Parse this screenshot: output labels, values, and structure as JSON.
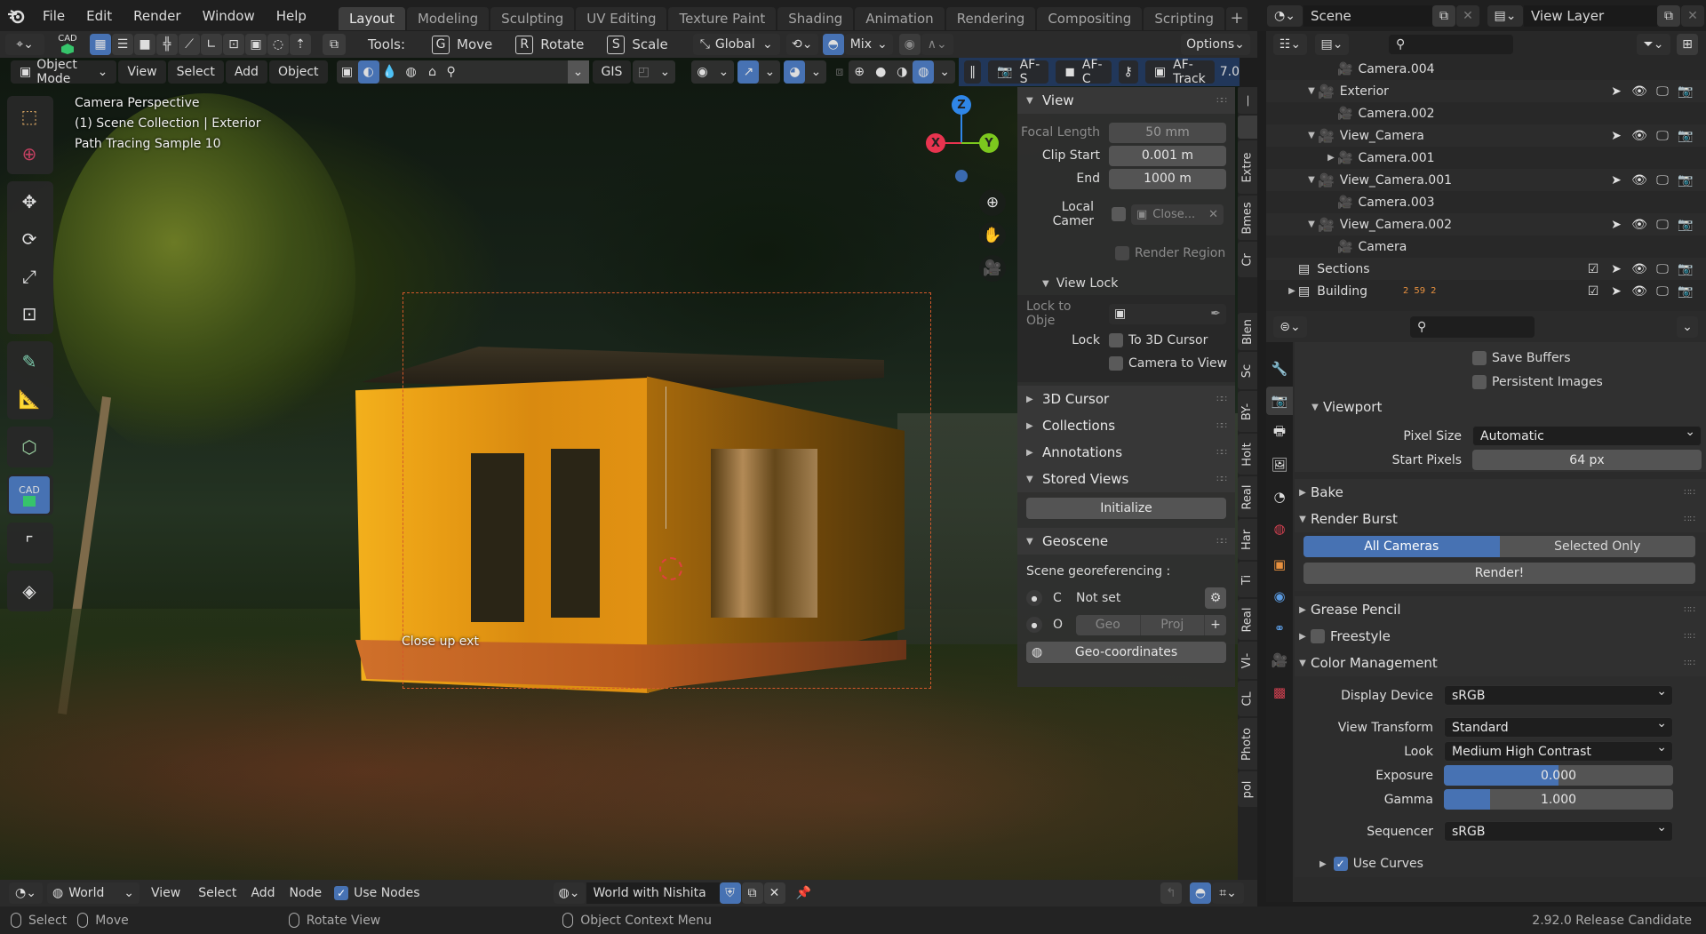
{
  "topbar": {
    "menus": [
      "File",
      "Edit",
      "Render",
      "Window",
      "Help"
    ],
    "workspaces": [
      "Layout",
      "Modeling",
      "Sculpting",
      "UV Editing",
      "Texture Paint",
      "Shading",
      "Animation",
      "Rendering",
      "Compositing",
      "Scripting"
    ],
    "active_workspace": "Layout",
    "scene": "Scene",
    "view_layer": "View Layer"
  },
  "toolheader": {
    "cad_label": "CAD",
    "tools_label": "Tools:",
    "move_key": "G",
    "move_label": "Move",
    "rotate_key": "R",
    "rotate_label": "Rotate",
    "scale_key": "S",
    "scale_label": "Scale",
    "orientation": "Global",
    "blend_mode": "Mix",
    "options_label": "Options"
  },
  "viewport_header": {
    "mode": "Object Mode",
    "menus": [
      "View",
      "Select",
      "Add",
      "Object"
    ],
    "gis_label": "GIS",
    "af_s": "AF-S",
    "af_c": "AF-C",
    "af_track": "AF-Track",
    "overflow_value": "7.0"
  },
  "viewport": {
    "info_lines": [
      "Camera Perspective",
      "(1) Scene Collection | Exterior",
      "Path Tracing Sample 10"
    ],
    "camera_label": "Close up ext",
    "gizmo": {
      "x": "X",
      "y": "Y",
      "z": "Z",
      "x_color": "#e8344f",
      "y_color": "#7cc81e",
      "z_color": "#2f86e8"
    }
  },
  "npanel": {
    "view": {
      "title": "View",
      "focal_length_label": "Focal Length",
      "focal_length": "50 mm",
      "clip_start_label": "Clip Start",
      "clip_start": "0.001 m",
      "end_label": "End",
      "end": "1000 m",
      "local_camera_label": "Local Camer",
      "local_camera_value": "Close...",
      "render_region_label": "Render Region",
      "view_lock_title": "View Lock",
      "lock_to_object_label": "Lock to Obje",
      "lock_label": "Lock",
      "to_3d_cursor": "To 3D Cursor",
      "camera_to_view": "Camera to View"
    },
    "sections": [
      "3D Cursor",
      "Collections",
      "Annotations",
      "Stored Views"
    ],
    "initialize_label": "Initialize",
    "geoscene": {
      "title": "Geoscene",
      "label": "Scene georeferencing :",
      "c_label": "C",
      "c_value": "Not set",
      "o_label": "O",
      "geo": "Geo",
      "proj": "Proj",
      "geo_coords": "Geo-coordinates"
    },
    "vertical_tabs": [
      "Extre",
      "Bmes",
      "Cr",
      "Blen",
      "Sc",
      "BY-",
      "Holt",
      "Real",
      "Har",
      "Ti",
      "Real",
      "VI-",
      "CL",
      "Photo",
      "pol"
    ]
  },
  "outliner": {
    "rows": [
      {
        "name": "Camera.004",
        "type": "camera",
        "indent": 3
      },
      {
        "name": "Exterior",
        "type": "collection-cam",
        "indent": 2,
        "expanded": true,
        "icons": true
      },
      {
        "name": "Camera.002",
        "type": "camera",
        "indent": 3
      },
      {
        "name": "View_Camera",
        "type": "collection-cam",
        "indent": 2,
        "expanded": true,
        "icons": true
      },
      {
        "name": "Camera.001",
        "type": "camera",
        "indent": 3,
        "collapsed": true
      },
      {
        "name": "View_Camera.001",
        "type": "collection-cam",
        "indent": 2,
        "expanded": true,
        "icons": true
      },
      {
        "name": "Camera.003",
        "type": "camera",
        "indent": 3
      },
      {
        "name": "View_Camera.002",
        "type": "collection-cam",
        "indent": 2,
        "expanded": true,
        "icons": true
      },
      {
        "name": "Camera",
        "type": "camera",
        "indent": 3
      },
      {
        "name": "Sections",
        "type": "collection",
        "indent": 1,
        "checkbox": true,
        "icons": true
      },
      {
        "name": "Building",
        "type": "collection",
        "indent": 1,
        "collapsed": true,
        "checkbox": true,
        "icons": true,
        "badges": [
          "2",
          "59",
          "2"
        ]
      }
    ]
  },
  "properties": {
    "save_buffers": "Save Buffers",
    "persistent_images": "Persistent Images",
    "viewport_title": "Viewport",
    "pixel_size_label": "Pixel Size",
    "pixel_size": "Automatic",
    "start_pixels_label": "Start Pixels",
    "start_pixels": "64 px",
    "bake": "Bake",
    "render_burst": "Render Burst",
    "all_cameras": "All Cameras",
    "selected_only": "Selected Only",
    "render_btn": "Render!",
    "grease_pencil": "Grease Pencil",
    "freestyle": "Freestyle",
    "color_management": "Color Management",
    "display_device_label": "Display Device",
    "display_device": "sRGB",
    "view_transform_label": "View Transform",
    "view_transform": "Standard",
    "look_label": "Look",
    "look": "Medium High Contrast",
    "exposure_label": "Exposure",
    "exposure": "0.000",
    "exposure_fill_pct": 50,
    "gamma_label": "Gamma",
    "gamma": "1.000",
    "gamma_fill_pct": 20,
    "sequencer_label": "Sequencer",
    "sequencer": "sRGB",
    "use_curves": "Use Curves"
  },
  "bottom_header": {
    "world_type": "World",
    "menus": [
      "View",
      "Select",
      "Add",
      "Node"
    ],
    "use_nodes": "Use Nodes",
    "world_name": "World with Nishita"
  },
  "statusbar": {
    "select": "Select",
    "move": "Move",
    "rotate_view": "Rotate View",
    "context_menu": "Object Context Menu",
    "version": "2.92.0 Release Candidate"
  }
}
